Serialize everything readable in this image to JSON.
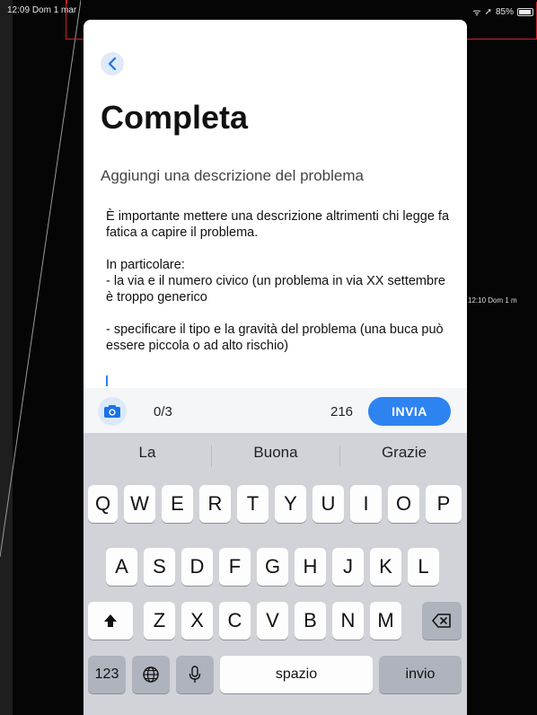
{
  "statusbar": {
    "time": "12:09",
    "date": "Dom 1 mar",
    "battery": "85%",
    "side_time": "12:10",
    "side_date": "Dom 1 m"
  },
  "header": {
    "back_icon": "chevron-left-icon",
    "title": "Completa",
    "subtitle": "Aggiungi una descrizione del problema"
  },
  "description": "È importante mettere una descrizione altrimenti chi legge fa fatica a capire il problema.\n\nIn particolare:\n- la via e il numero civico (un problema in via XX settembre è troppo generico\n\n- specificare il tipo e la gravità del problema (una buca può essere piccola o ad alto rischio)",
  "toolbar": {
    "camera_icon": "camera-icon",
    "photo_count": "0/3",
    "char_count": "216",
    "send_label": "INVIA"
  },
  "keyboard": {
    "suggestions": [
      "La",
      "Buona",
      "Grazie"
    ],
    "row1": [
      "Q",
      "W",
      "E",
      "R",
      "T",
      "Y",
      "U",
      "I",
      "O",
      "P"
    ],
    "row2": [
      "A",
      "S",
      "D",
      "F",
      "G",
      "H",
      "J",
      "K",
      "L"
    ],
    "row3": [
      "Z",
      "X",
      "C",
      "V",
      "B",
      "N",
      "M"
    ],
    "numbers_label": "123",
    "space_label": "spazio",
    "return_label": "invio"
  },
  "colors": {
    "accent": "#2d84f0",
    "annotation": "#d0202a"
  }
}
